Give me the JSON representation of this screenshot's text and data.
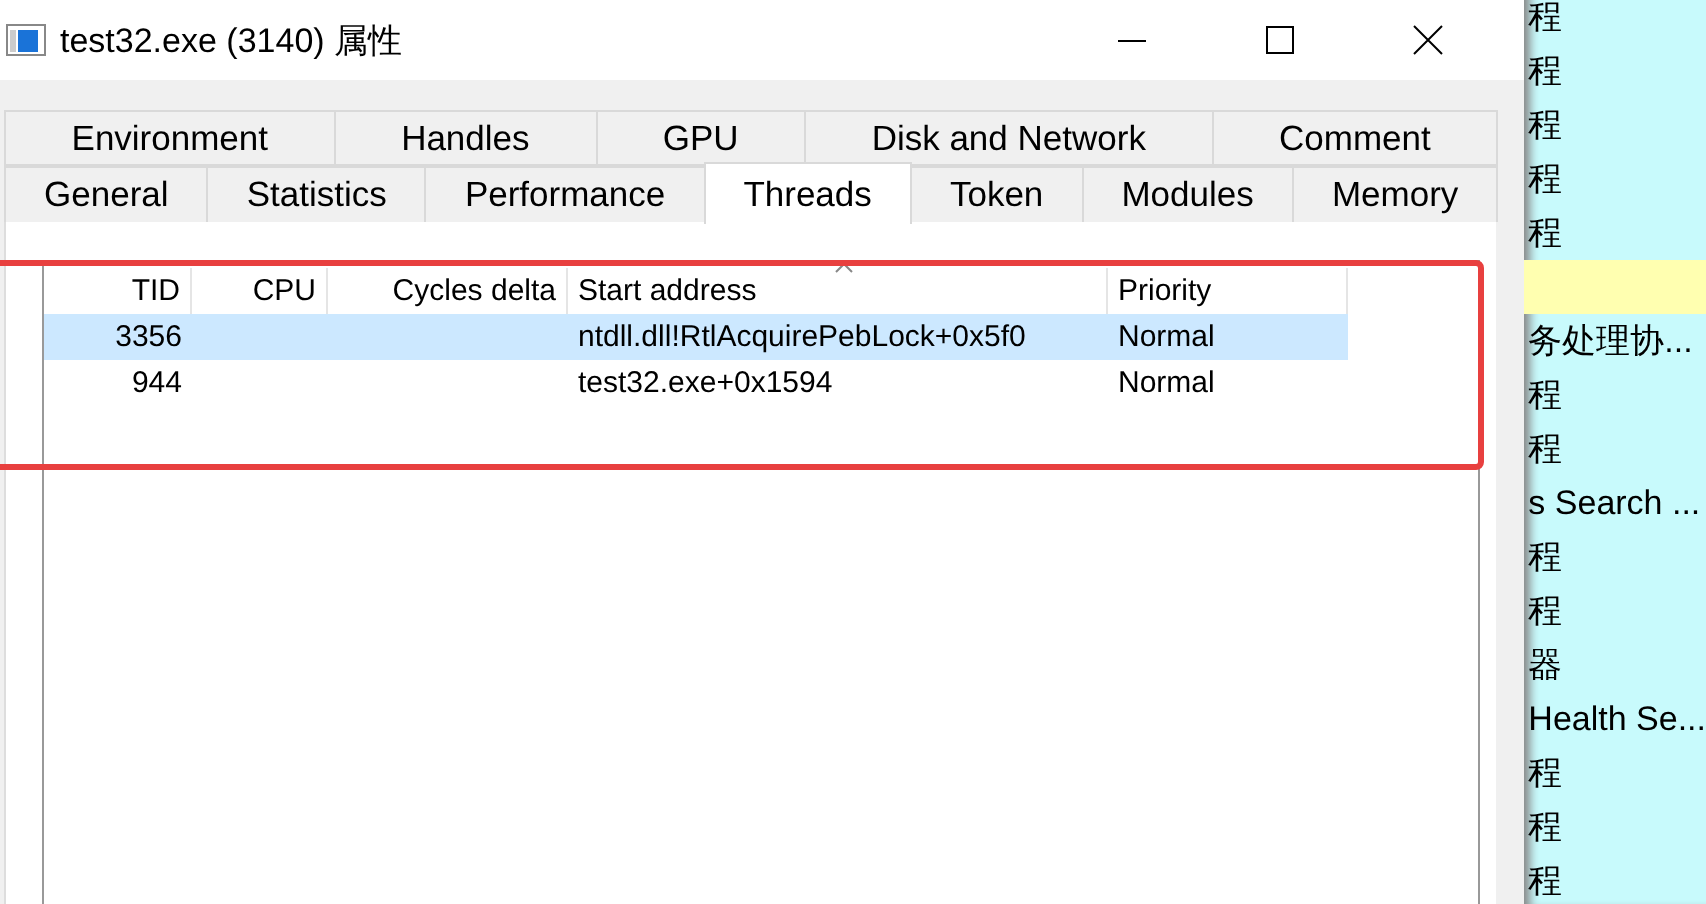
{
  "window": {
    "title": "test32.exe (3140) 属性"
  },
  "tab_rows": [
    [
      {
        "label": "Environment",
        "selected": false
      },
      {
        "label": "Handles",
        "selected": false
      },
      {
        "label": "GPU",
        "selected": false
      },
      {
        "label": "Disk and Network",
        "selected": false
      },
      {
        "label": "Comment",
        "selected": false
      }
    ],
    [
      {
        "label": "General",
        "selected": false
      },
      {
        "label": "Statistics",
        "selected": false
      },
      {
        "label": "Performance",
        "selected": false
      },
      {
        "label": "Threads",
        "selected": true
      },
      {
        "label": "Token",
        "selected": false
      },
      {
        "label": "Modules",
        "selected": false
      },
      {
        "label": "Memory",
        "selected": false
      }
    ]
  ],
  "table": {
    "columns": [
      "TID",
      "CPU",
      "Cycles delta",
      "Start address",
      "Priority"
    ],
    "rows": [
      {
        "cells": [
          "3356",
          "",
          "",
          "ntdll.dll!RtlAcquirePebLock+0x5f0",
          "Normal"
        ],
        "selected": true
      },
      {
        "cells": [
          "944",
          "",
          "",
          "test32.exe+0x1594",
          "Normal"
        ],
        "selected": false
      }
    ]
  },
  "background_list": {
    "items": [
      {
        "text": "程",
        "highlighted": false
      },
      {
        "text": "程",
        "highlighted": false
      },
      {
        "text": "程",
        "highlighted": false
      },
      {
        "text": "程",
        "highlighted": false
      },
      {
        "text": "程",
        "highlighted": false
      },
      {
        "highlighted": true
      },
      {
        "text": "务处理协...",
        "highlighted": false
      },
      {
        "text": "程",
        "highlighted": false
      },
      {
        "text": "程",
        "highlighted": false
      },
      {
        "text": "s Search ...",
        "highlighted": false
      },
      {
        "text": "程",
        "highlighted": false
      },
      {
        "text": "程",
        "highlighted": false
      },
      {
        "text": "器",
        "highlighted": false
      },
      {
        "text": "Health Se...",
        "highlighted": false
      },
      {
        "text": "程",
        "highlighted": false
      },
      {
        "text": "程",
        "highlighted": false
      },
      {
        "text": "程",
        "highlighted": false
      }
    ]
  }
}
